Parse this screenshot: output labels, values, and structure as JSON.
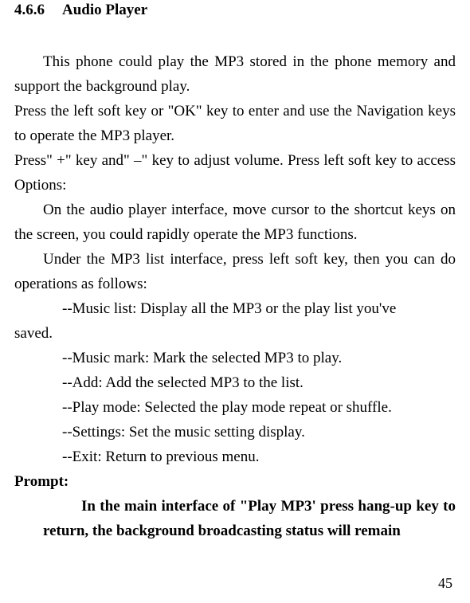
{
  "section": {
    "number": "4.6.6",
    "title": "Audio Player"
  },
  "para_intro": "This phone could play the MP3 stored in the phone memory and support the background play.",
  "para_press_ok": "Press the left soft key or \"OK\" key to enter and use the Navigation keys to operate the MP3 player.",
  "para_press_plus": "Press\" +\" key and\" –\" key to adjust volume. Press left soft key to access Options:",
  "para_cursor": "On the audio player interface, move cursor to the shortcut keys on the screen, you could rapidly operate the MP3 functions.",
  "para_list_intro": "Under the MP3 list interface, press left soft key, then you can do operations as follows:",
  "bullets": {
    "music_list_line1": "--Music list: Display all the MP3 or the play list you've",
    "music_list_line2": "saved.",
    "music_mark": "--Music mark: Mark the selected MP3 to play.",
    "add": "--Add: Add the selected MP3 to the list.",
    "play_mode": "--Play mode: Selected the play mode repeat or shuffle.",
    "settings": "--Settings: Set the music setting display.",
    "exit": "--Exit: Return to previous menu."
  },
  "prompt_label": "Prompt:",
  "prompt_body": "In the main interface of \"Play MP3' press hang-up key to return, the background broadcasting status will remain",
  "page_number": "45"
}
